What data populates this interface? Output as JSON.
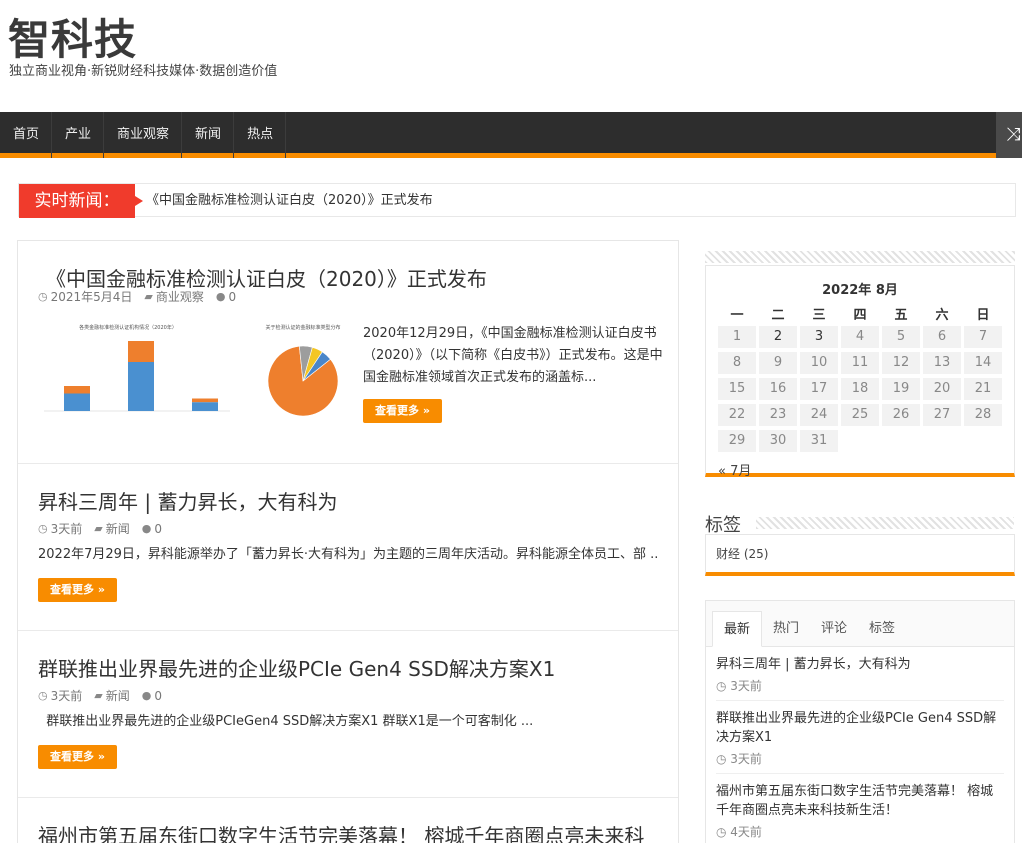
{
  "header": {
    "title": "智科技",
    "description": "独立商业视角·新锐财经科技媒体·数据创造价值"
  },
  "nav": {
    "items": [
      "首页",
      "产业",
      "商业观察",
      "新闻",
      "热点"
    ],
    "shuffle_icon": "shuffle-icon"
  },
  "ticker": {
    "label": "实时新闻：",
    "text": "《中国金融标准检测认证白皮（2020）》正式发布"
  },
  "posts": [
    {
      "title": "《中国金融标准检测认证白皮（2020）》正式发布",
      "date": "2021年5月4日",
      "category": "商业观察",
      "comments": "0",
      "excerpt": "2020年12月29日，《中国金融标准检测认证白皮书（2020）》（以下简称《白皮书》）正式发布。这是中国金融标准领域首次正式发布的涵盖标...",
      "more": "查看更多 »",
      "thumb": {
        "bar_title": "各类金融标准检测认证机构情况（2020年）",
        "bar_values": [
          10,
          28,
          5
        ],
        "pie_title": "关于检测认证的金融标准类型分布",
        "pie_values": [
          84,
          6,
          5,
          5
        ],
        "pie_colors": [
          "#ee7f2d",
          "#9d9d9d",
          "#f3c623",
          "#4a86c8"
        ]
      }
    },
    {
      "title": "昇科三周年 | 蓄力昇长，大有科为",
      "date": "3天前",
      "category": "新闻",
      "comments": "0",
      "excerpt": "2022年7月29日，昇科能源举办了「蓄力昇长·大有科为」为主题的三周年庆活动。昇科能源全体员工、部 ...",
      "more": "查看更多 »"
    },
    {
      "title": "群联推出业界最先进的企业级PCIe Gen4 SSD解决方案X1",
      "date": "3天前",
      "category": "新闻",
      "comments": "0",
      "excerpt": "  群联推出业界最先进的企业级PCIeGen4 SSD解决方案X1 群联X1是一个可客制化 ...",
      "more": "查看更多 »"
    },
    {
      "title": "福州市第五届东街口数字生活节完美落幕！ 榕城千年商圈点亮未来科"
    }
  ],
  "calendar": {
    "caption": "2022年 8月",
    "weekdays": [
      "一",
      "二",
      "三",
      "四",
      "五",
      "六",
      "日"
    ],
    "days": [
      "1",
      "2",
      "3",
      "4",
      "5",
      "6",
      "7",
      "8",
      "9",
      "10",
      "11",
      "12",
      "13",
      "14",
      "15",
      "16",
      "17",
      "18",
      "19",
      "20",
      "21",
      "22",
      "23",
      "24",
      "25",
      "26",
      "27",
      "28",
      "29",
      "30",
      "31"
    ],
    "highlight_days": [
      "2",
      "3"
    ],
    "prev": "« 7月"
  },
  "tags": {
    "title": "标签",
    "items": [
      "财经 (25)"
    ]
  },
  "tabs": {
    "labels": [
      "最新",
      "热门",
      "评论",
      "标签"
    ],
    "active": 0,
    "items": [
      {
        "title": "昇科三周年 | 蓄力昇长，大有科为",
        "time": "3天前"
      },
      {
        "title": "群联推出业界最先进的企业级PCIe Gen4 SSD解决方案X1",
        "time": "3天前"
      },
      {
        "title": "福州市第五届东街口数字生活节完美落幕！ 榕城千年商圈点亮未来科技新生活！",
        "time": "4天前"
      }
    ]
  }
}
